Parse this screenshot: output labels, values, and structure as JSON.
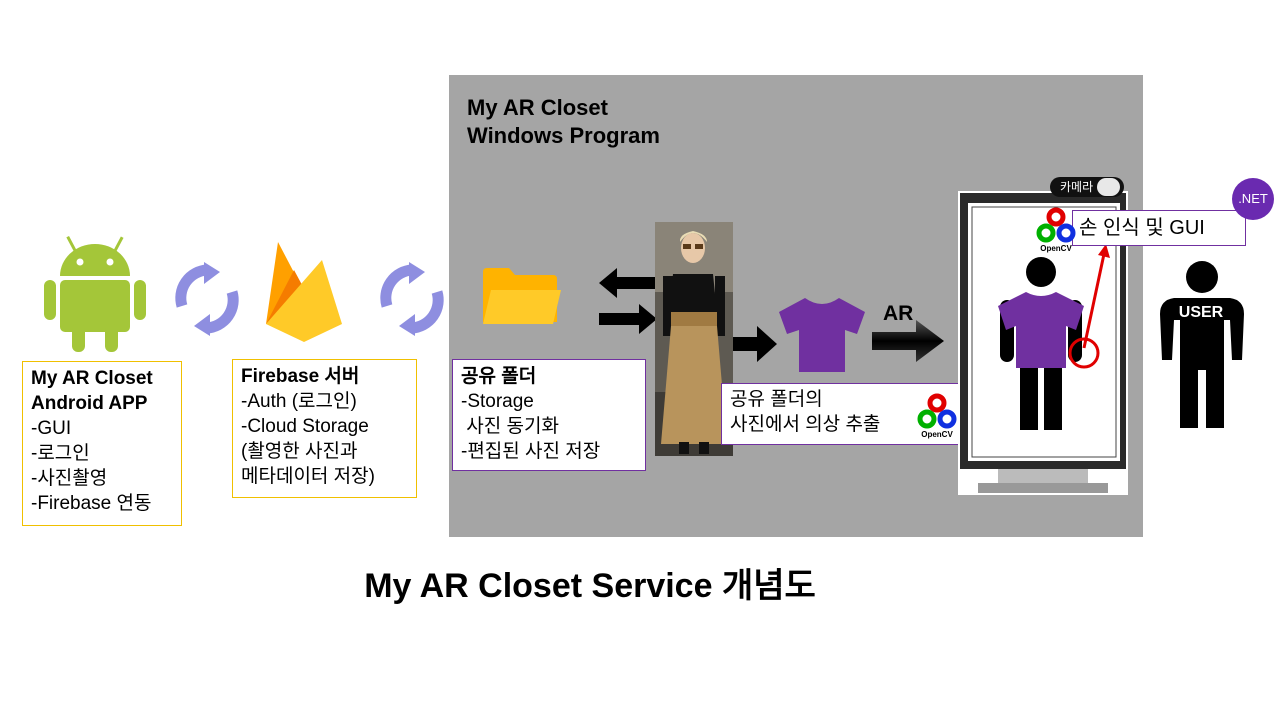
{
  "title": "My AR Closet Service 개념도",
  "android_box": {
    "title_line1": "My AR Closet",
    "title_line2": "Android APP",
    "items": [
      "-GUI",
      "-로그인",
      "-사진촬영",
      "-Firebase 연동"
    ]
  },
  "firebase_box": {
    "title": "Firebase 서버",
    "items": [
      "-Auth (로그인)",
      "-Cloud Storage",
      "(촬영한 사진과",
      "메타데이터 저장)"
    ]
  },
  "windows_panel": {
    "title_line1": "My AR Closet",
    "title_line2": "Windows Program"
  },
  "shared_folder_box": {
    "title": "공유 폴더",
    "items": [
      "-Storage",
      " 사진 동기화",
      "-편집된 사진 저장"
    ]
  },
  "extract_box": {
    "line1": "공유 폴더의",
    "line2": "사진에서 의상 추출"
  },
  "ar_label": "AR",
  "camera_label": "카메라",
  "hand_box": {
    "label": "손 인식 및 GUI"
  },
  "user_label": "USER",
  "net_label": ".NET",
  "opencv_label": "OpenCV",
  "colors": {
    "android_green": "#a4c639",
    "sync_arrows": "#8e8ee0",
    "firebase_yellow": "#ffca28",
    "firebase_orange": "#f57c00",
    "folder_yellow": "#ffc107",
    "shirt_purple": "#7030a0",
    "gray_panel": "#a5a5a5",
    "red_accent": "#e00000"
  },
  "icons": [
    "android-icon",
    "sync-icon",
    "firebase-icon",
    "folder-icon",
    "photo-model",
    "shirt-icon",
    "monitor",
    "opencv-logo",
    "net-badge",
    "user-figure"
  ]
}
